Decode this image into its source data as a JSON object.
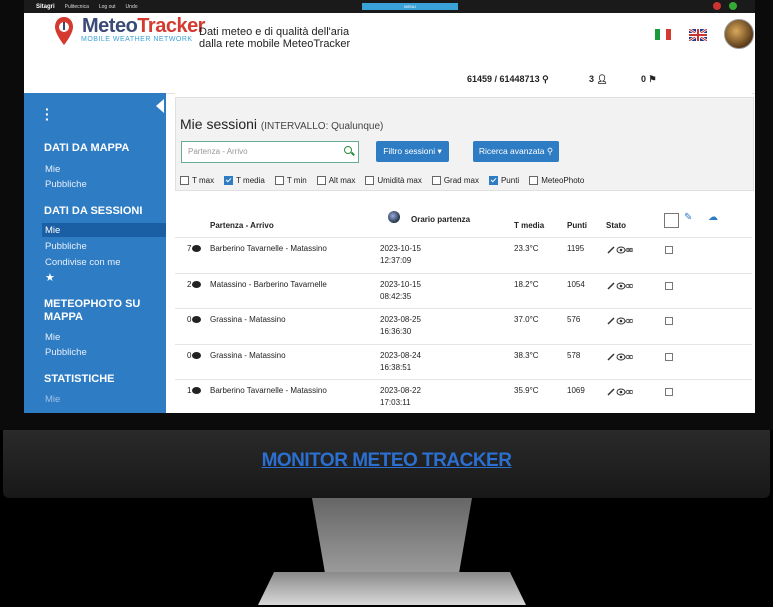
{
  "topbar": {
    "brand": "Sitagri",
    "items": [
      "Pulitecnica",
      "Log out",
      "Undo"
    ],
    "center": "MENU"
  },
  "header": {
    "logo": {
      "title_part1": "Meteo",
      "title_part2": "Tracker",
      "subtitle": "MOBILE WEATHER NETWORK"
    },
    "tagline_line1": "Dati meteo e di qualità dell'aria",
    "tagline_line2": "dalla rete mobile MeteoTracker",
    "stats": {
      "points": "61459 / 61448713",
      "users": "3",
      "followers": "0"
    }
  },
  "sidebar": {
    "sections": [
      {
        "title": "DATI DA MAPPA",
        "items": [
          "Mie",
          "Pubbliche"
        ]
      },
      {
        "title": "DATI DA SESSIONI",
        "items": [
          "Mie",
          "Pubbliche",
          "Condivise con me",
          "★"
        ]
      },
      {
        "title_line1": "METEOPHOTO SU",
        "title_line2": "MAPPA",
        "items": [
          "Mie",
          "Pubbliche"
        ]
      },
      {
        "title": "STATISTICHE",
        "items": [
          "Mie"
        ]
      }
    ]
  },
  "panel": {
    "title": "Mie sessioni",
    "subtitle": "(INTERVALLO: Qualunque)",
    "search_placeholder": "Partenza - Arrivo",
    "filter_button": "Filtro sessioni",
    "advanced_button": "Ricerca avanzata",
    "filters": [
      {
        "label": "T max",
        "checked": false
      },
      {
        "label": "T media",
        "checked": true
      },
      {
        "label": "T min",
        "checked": false
      },
      {
        "label": "Alt max",
        "checked": false
      },
      {
        "label": "Umidità max",
        "checked": false
      },
      {
        "label": "Grad max",
        "checked": false
      },
      {
        "label": "Punti",
        "checked": true
      },
      {
        "label": "MeteoPhoto",
        "checked": false
      }
    ]
  },
  "table": {
    "headers": {
      "route": "Partenza - Arrivo",
      "start": "Orario partenza",
      "tmean": "T media",
      "points": "Punti",
      "state": "Stato"
    },
    "rows": [
      {
        "views": "7",
        "route": "Barberino Tavarnelle - Matassino",
        "date": "2023-10-15",
        "time": "12:37:09",
        "tmean": "23.3°C",
        "points": "1195"
      },
      {
        "views": "2",
        "route": "Matassino - Barberino Tavarnelle",
        "date": "2023-10-15",
        "time": "08:42:35",
        "tmean": "18.2°C",
        "points": "1054"
      },
      {
        "views": "0",
        "route": "Grassina - Matassino",
        "date": "2023-08-25",
        "time": "16:36:30",
        "tmean": "37.0°C",
        "points": "576"
      },
      {
        "views": "0",
        "route": "Grassina - Matassino",
        "date": "2023-08-24",
        "time": "16:38:51",
        "tmean": "38.3°C",
        "points": "578"
      },
      {
        "views": "1",
        "route": "Barberino Tavarnelle - Matassino",
        "date": "2023-08-22",
        "time": "17:03:11",
        "tmean": "35.9°C",
        "points": "1069"
      }
    ]
  },
  "monitor_label": "MONITOR METEO TRACKER",
  "colors": {
    "accent": "#2e7cc4",
    "logo_blue": "#3b4b78",
    "logo_red": "#d43a30"
  }
}
